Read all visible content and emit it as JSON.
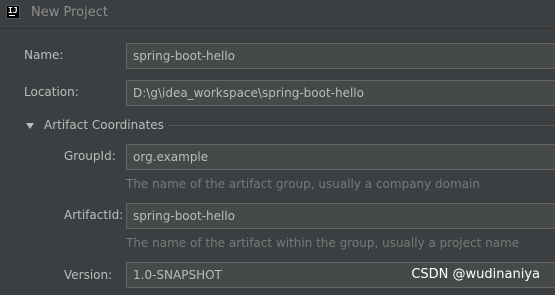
{
  "window": {
    "title": "New Project",
    "icon": "intellij-idea-icon"
  },
  "form": {
    "name": {
      "label": "Name:",
      "value": "spring-boot-hello"
    },
    "location": {
      "label": "Location:",
      "value": "D:\\g\\idea_workspace\\spring-boot-hello"
    }
  },
  "artifact": {
    "section_title": "Artifact Coordinates",
    "expanded": true,
    "groupId": {
      "label": "GroupId:",
      "value": "org.example",
      "hint": "The name of the artifact group, usually a company domain"
    },
    "artifactId": {
      "label": "ArtifactId:",
      "value": "spring-boot-hello",
      "hint": "The name of the artifact within the group, usually a project name"
    },
    "version": {
      "label": "Version:",
      "value": "1.0-SNAPSHOT"
    }
  },
  "watermark": "CSDN @wudinaniya"
}
